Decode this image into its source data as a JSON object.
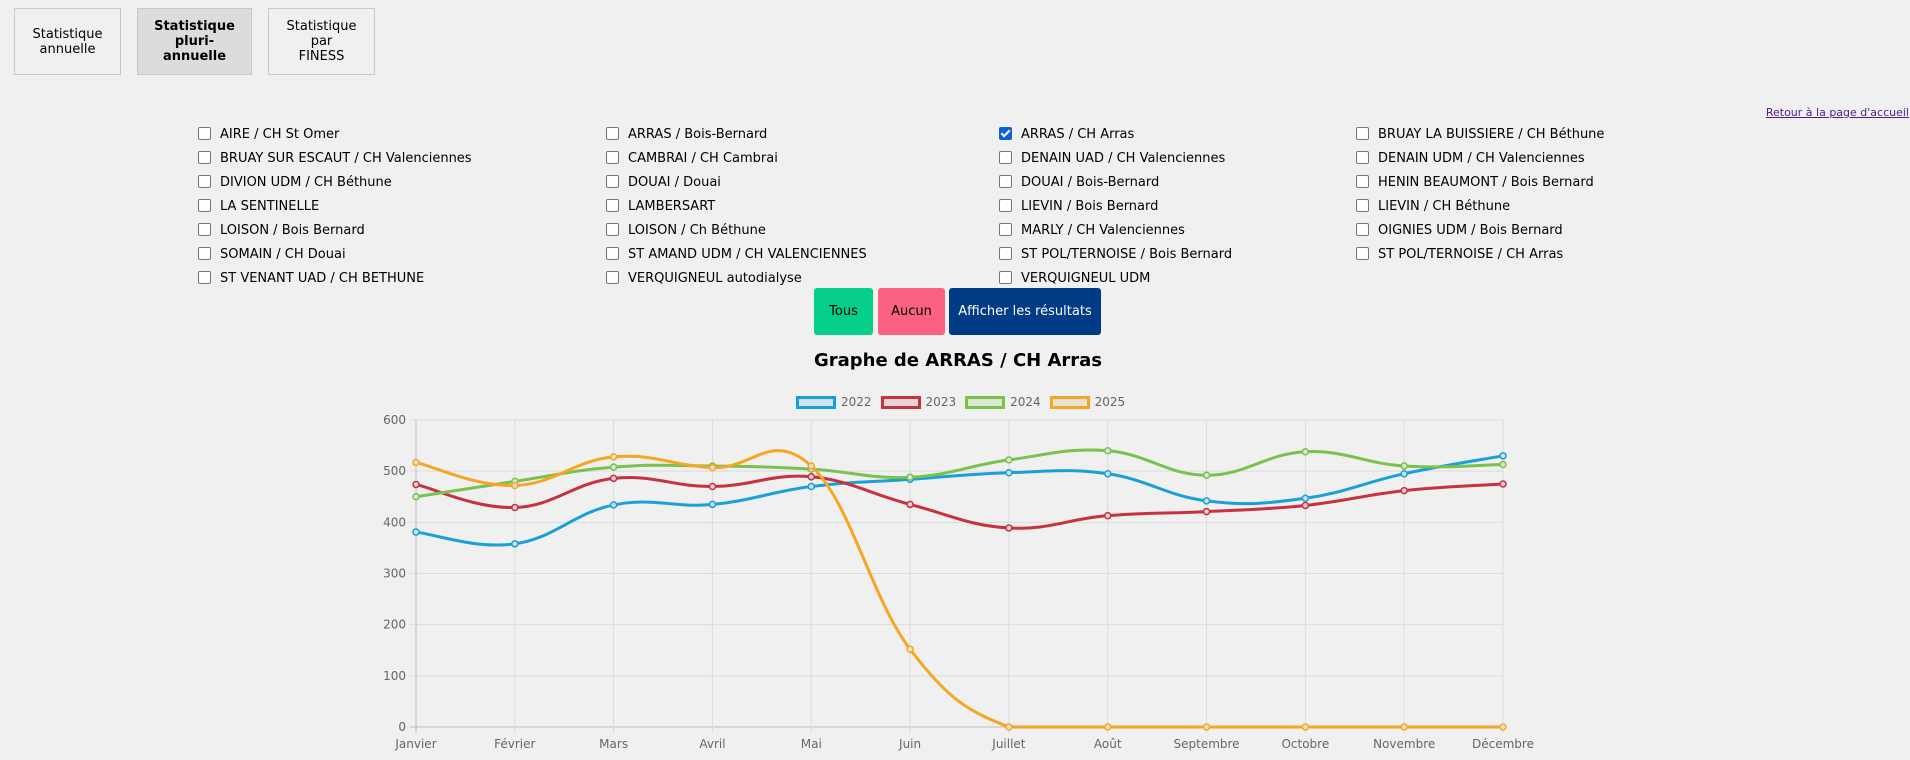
{
  "tabs": [
    {
      "label": "Statistique\nannuelle",
      "active": false
    },
    {
      "label": "Statistique\npluri-\nannuelle",
      "active": true
    },
    {
      "label": "Statistique\npar\nFINESS",
      "active": false
    }
  ],
  "home_link": "Retour à la page d'accueil",
  "sites": [
    {
      "label": "AIRE / CH St Omer",
      "checked": false
    },
    {
      "label": "ARRAS / Bois-Bernard",
      "checked": false
    },
    {
      "label": "ARRAS / CH Arras",
      "checked": true
    },
    {
      "label": "BRUAY LA BUISSIERE / CH Béthune",
      "checked": false
    },
    {
      "label": "BRUAY SUR ESCAUT / CH Valenciennes",
      "checked": false
    },
    {
      "label": "CAMBRAI / CH Cambrai",
      "checked": false
    },
    {
      "label": "DENAIN UAD / CH Valenciennes",
      "checked": false
    },
    {
      "label": "DENAIN UDM / CH Valenciennes",
      "checked": false
    },
    {
      "label": "DIVION UDM / CH Béthune",
      "checked": false
    },
    {
      "label": "DOUAI / Douai",
      "checked": false
    },
    {
      "label": "DOUAI / Bois-Bernard",
      "checked": false
    },
    {
      "label": "HENIN BEAUMONT / Bois Bernard",
      "checked": false
    },
    {
      "label": "LA SENTINELLE",
      "checked": false
    },
    {
      "label": "LAMBERSART",
      "checked": false
    },
    {
      "label": "LIEVIN / Bois Bernard",
      "checked": false
    },
    {
      "label": "LIEVIN / CH Béthune",
      "checked": false
    },
    {
      "label": "LOISON / Bois Bernard",
      "checked": false
    },
    {
      "label": "LOISON / Ch Béthune",
      "checked": false
    },
    {
      "label": "MARLY / CH Valenciennes",
      "checked": false
    },
    {
      "label": "OIGNIES UDM / Bois Bernard",
      "checked": false
    },
    {
      "label": "SOMAIN / CH Douai",
      "checked": false
    },
    {
      "label": "ST AMAND UDM / CH VALENCIENNES",
      "checked": false
    },
    {
      "label": "ST POL/TERNOISE / Bois Bernard",
      "checked": false
    },
    {
      "label": "ST POL/TERNOISE / CH Arras",
      "checked": false
    },
    {
      "label": "ST VENANT UAD / CH BETHUNE",
      "checked": false
    },
    {
      "label": "VERQUIGNEUL autodialyse",
      "checked": false
    },
    {
      "label": "VERQUIGNEUL UDM",
      "checked": false
    }
  ],
  "actions": {
    "all": "Tous",
    "none": "Aucun",
    "show": "Afficher les résultats"
  },
  "chart_data": {
    "type": "line",
    "title": "Graphe de ARRAS / CH Arras",
    "categories": [
      "Janvier",
      "Février",
      "Mars",
      "Avril",
      "Mai",
      "Juin",
      "Juillet",
      "Août",
      "Septembre",
      "Octobre",
      "Novembre",
      "Décembre"
    ],
    "ylim": [
      0,
      600
    ],
    "yticks": [
      0,
      100,
      200,
      300,
      400,
      500,
      600
    ],
    "grid": true,
    "legend_position": "top",
    "series": [
      {
        "name": "2022",
        "color": "#1aa0d8",
        "fill": "#cfe3ee",
        "values": [
          381,
          358,
          434,
          435,
          470,
          484,
          497,
          495,
          442,
          447,
          495,
          530
        ]
      },
      {
        "name": "2023",
        "color": "#c8313f",
        "fill": "#e6d4d7",
        "values": [
          474,
          429,
          486,
          470,
          489,
          435,
          389,
          413,
          421,
          433,
          462,
          475
        ]
      },
      {
        "name": "2024",
        "color": "#79c24e",
        "fill": "#dbe6d0",
        "values": [
          450,
          480,
          508,
          510,
          504,
          488,
          522,
          540,
          492,
          538,
          510,
          513
        ]
      },
      {
        "name": "2025",
        "color": "#f5a623",
        "fill": "#e9e1d3",
        "values": [
          517,
          472,
          528,
          507,
          510,
          152,
          0,
          0,
          0,
          0,
          0,
          0
        ]
      }
    ]
  }
}
